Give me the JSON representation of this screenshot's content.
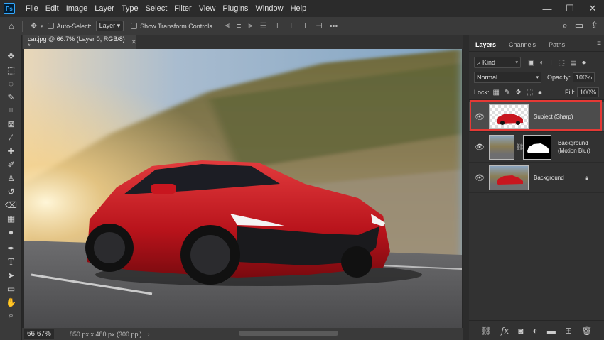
{
  "app": {
    "logo": "Ps"
  },
  "menu": [
    "File",
    "Edit",
    "Image",
    "Layer",
    "Type",
    "Select",
    "Filter",
    "View",
    "Plugins",
    "Window",
    "Help"
  ],
  "window_controls": {
    "minimize": "—",
    "maximize": "☐",
    "close": "✕"
  },
  "options_bar": {
    "auto_select_label": "Auto-Select:",
    "auto_select_target": "Layer",
    "show_transform_label": "Show Transform Controls",
    "more": "•••"
  },
  "document": {
    "tab_title": "car.jpg @ 66.7% (Layer 0, RGB/8) *",
    "close": "✕",
    "zoom": "66.67%",
    "info": "850 px x 480 px (300 ppi)",
    "chevron": "›"
  },
  "layers_panel": {
    "tabs": [
      "Layers",
      "Channels",
      "Paths"
    ],
    "active_tab": "Layers",
    "kind_filter": "Kind",
    "blend_mode": "Normal",
    "opacity_label": "Opacity:",
    "opacity_value": "100%",
    "lock_label": "Lock:",
    "fill_label": "Fill:",
    "fill_value": "100%",
    "layers": [
      {
        "name": "Subject (Sharp)",
        "selected": true,
        "visible": true,
        "has_mask": false,
        "locked": false
      },
      {
        "name_line1": "Background",
        "name_line2": "(Motion Blur)",
        "selected": false,
        "visible": true,
        "has_mask": true,
        "locked": false
      },
      {
        "name": "Background",
        "selected": false,
        "visible": true,
        "has_mask": false,
        "locked": true
      }
    ],
    "footer_icons": [
      "link-icon",
      "fx-icon",
      "mask-icon",
      "adjustment-icon",
      "folder-icon",
      "new-layer-icon",
      "trash-icon"
    ]
  },
  "colors": {
    "accent_highlight": "#e53935",
    "panel_bg": "#323232",
    "car_red": "#c8161f"
  }
}
